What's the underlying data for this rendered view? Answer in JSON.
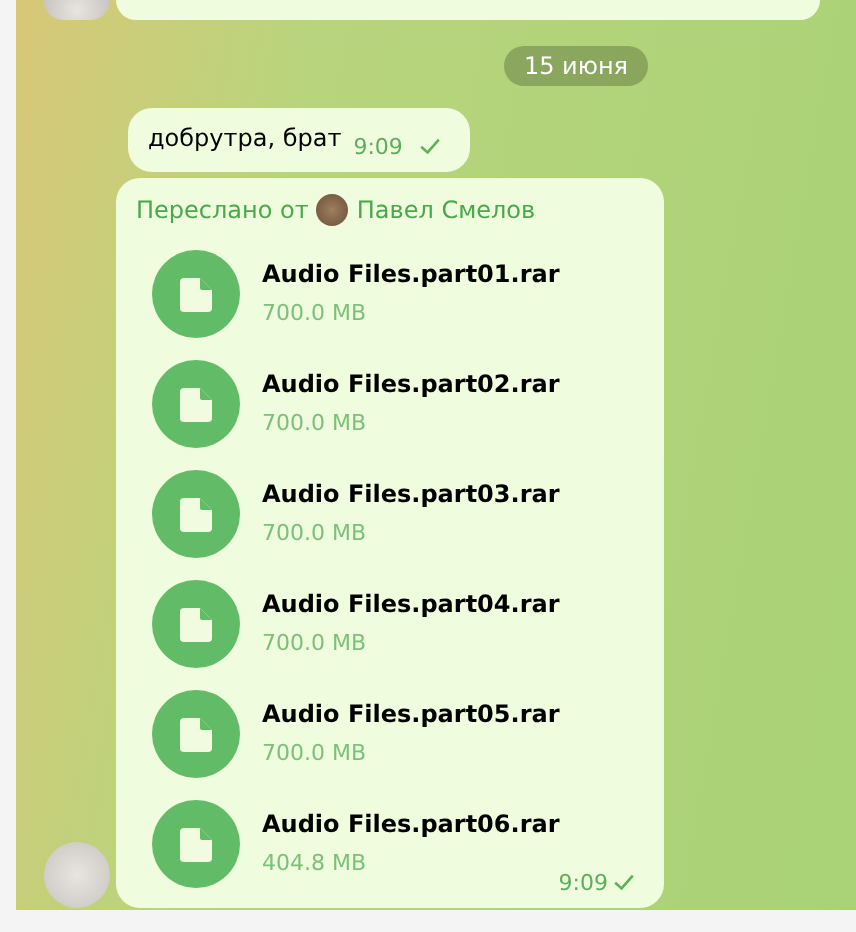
{
  "date_badge": "15 июня",
  "text_message": {
    "text": "добрутра, брат",
    "time": "9:09",
    "read": false
  },
  "forwarded_message": {
    "forwarded_label": "Переслано от",
    "forwarded_from": "Павел Смелов",
    "time": "9:09",
    "read": false,
    "files": [
      {
        "name": "Audio Files.part01.rar",
        "size": "700.0 MB"
      },
      {
        "name": "Audio Files.part02.rar",
        "size": "700.0 MB"
      },
      {
        "name": "Audio Files.part03.rar",
        "size": "700.0 MB"
      },
      {
        "name": "Audio Files.part04.rar",
        "size": "700.0 MB"
      },
      {
        "name": "Audio Files.part05.rar",
        "size": "700.0 MB"
      },
      {
        "name": "Audio Files.part06.rar",
        "size": "404.8 MB"
      }
    ]
  }
}
